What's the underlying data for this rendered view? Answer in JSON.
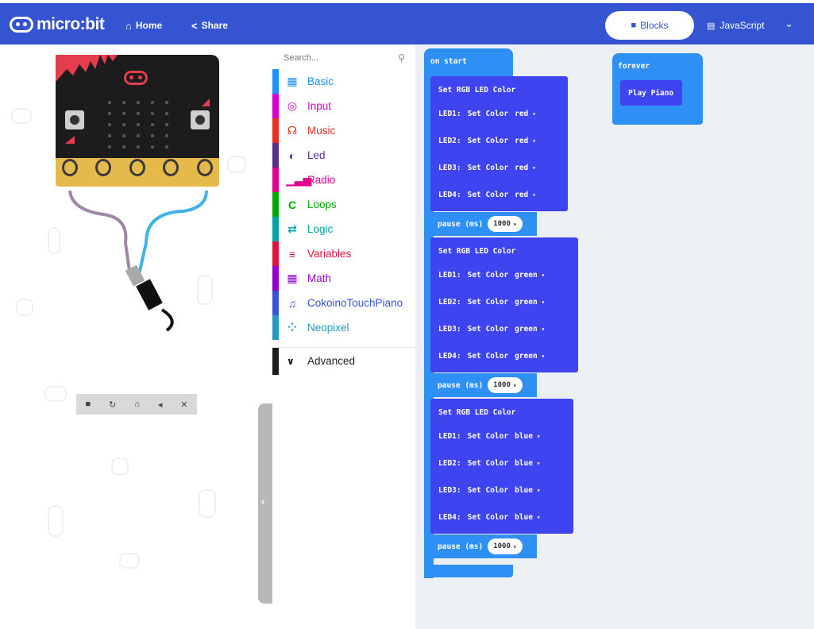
{
  "header": {
    "logo_text": "micro:bit",
    "home_label": "Home",
    "share_label": "Share",
    "blocks_label": "Blocks",
    "javascript_label": "JavaScript"
  },
  "toolbox": {
    "search_placeholder": "Search...",
    "categories": [
      {
        "label": "Basic",
        "color": "#1e90ff",
        "icon": "grid-icon"
      },
      {
        "label": "Input",
        "color": "#d400d4",
        "icon": "target-icon"
      },
      {
        "label": "Music",
        "color": "#e63022",
        "icon": "headphones-icon"
      },
      {
        "label": "Led",
        "color": "#5c2d91",
        "icon": "toggle-icon"
      },
      {
        "label": "Radio",
        "color": "#e3008c",
        "icon": "signal-icon"
      },
      {
        "label": "Loops",
        "color": "#00aa00",
        "icon": "refresh-icon"
      },
      {
        "label": "Logic",
        "color": "#00a4a6",
        "icon": "shuffle-icon"
      },
      {
        "label": "Variables",
        "color": "#dc143c",
        "icon": "list-icon"
      },
      {
        "label": "Math",
        "color": "#9400d3",
        "icon": "calculator-icon"
      },
      {
        "label": "CokoinoTouchPiano",
        "color": "#3455db",
        "icon": "music-note-icon"
      },
      {
        "label": "Neopixel",
        "color": "#2699bf",
        "icon": "spinner-icon"
      }
    ],
    "advanced_label": "Advanced"
  },
  "workspace": {
    "on_start_label": "on start",
    "forever_label": "forever",
    "play_piano_label": "Play Piano",
    "set_rgb_label": "Set RGB LED Color",
    "set_color_label": "Set Color",
    "pause_label": "pause (ms)",
    "color_groups": [
      {
        "color": "red",
        "pause": "1000",
        "leds": [
          "LED1:",
          "LED2:",
          "LED3:",
          "LED4:"
        ]
      },
      {
        "color": "green",
        "pause": "1000",
        "leds": [
          "LED1:",
          "LED2:",
          "LED3:",
          "LED4:"
        ]
      },
      {
        "color": "blue",
        "pause": "1000",
        "leds": [
          "LED1:",
          "LED2:",
          "LED3:",
          "LED4:"
        ]
      }
    ]
  },
  "colors": {
    "header_bg": "#3454d1",
    "event_block": "#2e8ff5",
    "custom_block": "#3d44f0",
    "workspace_bg": "#ecf0f4"
  }
}
